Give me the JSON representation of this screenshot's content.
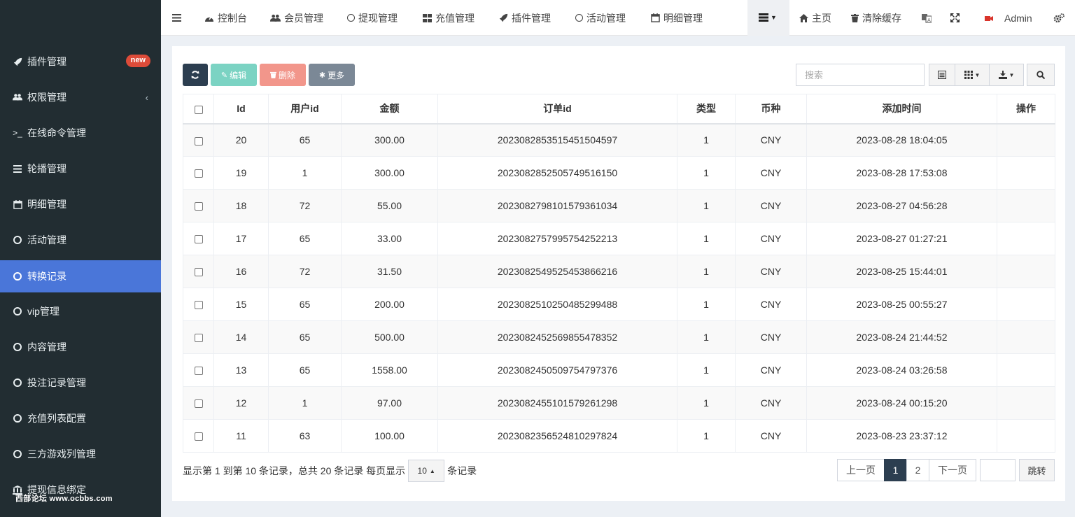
{
  "sidebar": {
    "items": [
      {
        "label": "插件管理",
        "icon": "rocket-icon",
        "badge": "new"
      },
      {
        "label": "权限管理",
        "icon": "users-icon",
        "caret": "‹"
      },
      {
        "label": "在线命令管理",
        "icon": "terminal-icon"
      },
      {
        "label": "轮播管理",
        "icon": "bars-icon"
      },
      {
        "label": "明细管理",
        "icon": "calendar-icon"
      },
      {
        "label": "活动管理",
        "icon": "circle-icon"
      },
      {
        "label": "转换记录",
        "icon": "circle-icon",
        "active": true
      },
      {
        "label": "vip管理",
        "icon": "circle-icon"
      },
      {
        "label": "内容管理",
        "icon": "circle-icon"
      },
      {
        "label": "投注记录管理",
        "icon": "circle-icon"
      },
      {
        "label": "充值列表配置",
        "icon": "circle-icon"
      },
      {
        "label": "三方游戏列管理",
        "icon": "circle-icon"
      },
      {
        "label": "提现信息绑定",
        "icon": "bank-icon"
      }
    ],
    "watermark": "西部论坛 www.ocbbs.com"
  },
  "topnav": {
    "tabs": [
      "控制台",
      "会员管理",
      "提现管理",
      "充值管理",
      "插件管理",
      "活动管理",
      "明细管理"
    ],
    "home": "主页",
    "clear_cache": "清除缓存",
    "admin": "Admin"
  },
  "toolbar": {
    "edit": "编辑",
    "delete": "删除",
    "more": "更多",
    "search_placeholder": "搜索"
  },
  "table": {
    "headers": [
      "Id",
      "用户id",
      "金额",
      "订单id",
      "类型",
      "币种",
      "添加时间",
      "操作"
    ],
    "rows": [
      [
        "20",
        "65",
        "300.00",
        "202308285351545150459​7",
        "1",
        "CNY",
        "2023-08-28 18:04:05",
        ""
      ],
      [
        "19",
        "1",
        "300.00",
        "2023082852505749516150",
        "1",
        "CNY",
        "2023-08-28 17:53:08",
        ""
      ],
      [
        "18",
        "72",
        "55.00",
        "2023082798101579361034",
        "1",
        "CNY",
        "2023-08-27 04:56:28",
        ""
      ],
      [
        "17",
        "65",
        "33.00",
        "2023082757995754252213",
        "1",
        "CNY",
        "2023-08-27 01:27:21",
        ""
      ],
      [
        "16",
        "72",
        "31.50",
        "2023082549525453866216",
        "1",
        "CNY",
        "2023-08-25 15:44:01",
        ""
      ],
      [
        "15",
        "65",
        "200.00",
        "2023082510250485299488",
        "1",
        "CNY",
        "2023-08-25 00:55:27",
        ""
      ],
      [
        "14",
        "65",
        "500.00",
        "2023082452569855478352",
        "1",
        "CNY",
        "2023-08-24 21:44:52",
        ""
      ],
      [
        "13",
        "65",
        "1558.00",
        "2023082450509754797376",
        "1",
        "CNY",
        "2023-08-24 03:26:58",
        ""
      ],
      [
        "12",
        "1",
        "97.00",
        "2023082455101579261298",
        "1",
        "CNY",
        "2023-08-24 00:15:20",
        ""
      ],
      [
        "11",
        "63",
        "100.00",
        "2023082356524810297824",
        "1",
        "CNY",
        "2023-08-23 23:37:12",
        ""
      ]
    ]
  },
  "footer": {
    "summary": "显示第 1 到第 10 条记录，总共 20 条记录 每页显示",
    "page_size": "10",
    "suffix": "条记录",
    "prev": "上一页",
    "pages": [
      "1",
      "2"
    ],
    "next": "下一页",
    "jump": "跳转"
  },
  "colors": {
    "sidebar_bg": "#222d32",
    "active_item": "#4a76d9",
    "badge": "#dd4b39",
    "refresh_btn": "#2c3e50",
    "edit_btn": "#7bd3c3",
    "delete_btn": "#f2968b",
    "more_btn": "#7b8896"
  }
}
